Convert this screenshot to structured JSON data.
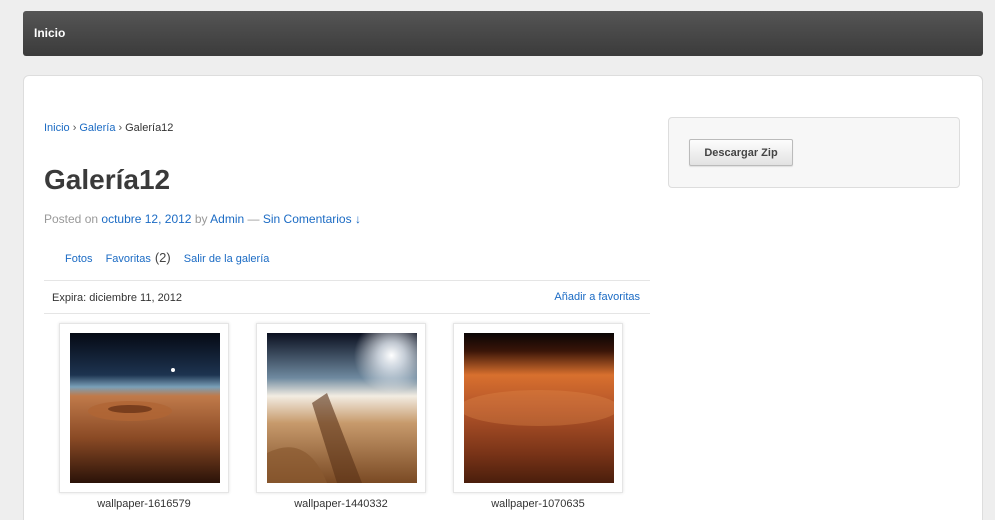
{
  "nav": {
    "home": "Inicio"
  },
  "breadcrumb": {
    "home": "Inicio",
    "gallery": "Galería",
    "current": "Galería12",
    "sep": "›"
  },
  "post": {
    "title": "Galería12",
    "posted_on": "Posted on",
    "date": "octubre 12, 2012",
    "by": "by",
    "author": "Admin",
    "dash": "—",
    "comments": "Sin Comentarios",
    "comments_arrow": "↓"
  },
  "gallery_nav": {
    "photos": "Fotos",
    "favorites": "Favoritas",
    "favorites_count": "(2)",
    "exit": "Salir de la galería"
  },
  "expiry": {
    "text": "Expira: diciembre 11, 2012",
    "add_favorites": "Añadir a favoritas"
  },
  "photos": [
    {
      "caption": "wallpaper-1616579"
    },
    {
      "caption": "wallpaper-1440332"
    },
    {
      "caption": "wallpaper-1070635"
    }
  ],
  "sidebar": {
    "download_zip": "Descargar Zip"
  }
}
